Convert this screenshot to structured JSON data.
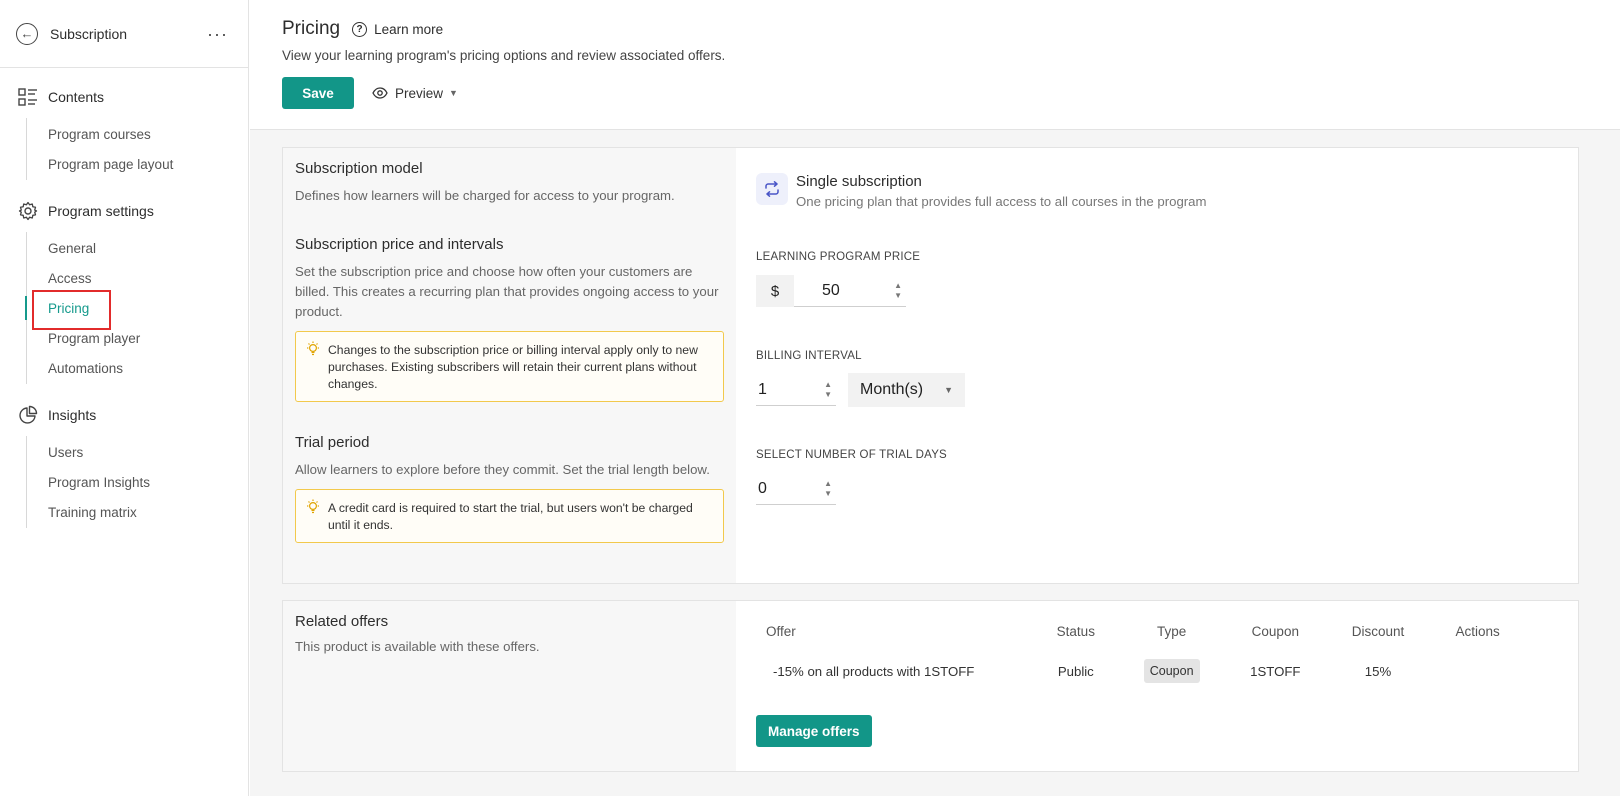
{
  "sidebar": {
    "title": "Subscription",
    "groups": [
      {
        "label": "Contents",
        "items": [
          {
            "label": "Program courses"
          },
          {
            "label": "Program page layout"
          }
        ]
      },
      {
        "label": "Program settings",
        "items": [
          {
            "label": "General"
          },
          {
            "label": "Access"
          },
          {
            "label": "Pricing",
            "active": true
          },
          {
            "label": "Program player"
          },
          {
            "label": "Automations"
          }
        ]
      },
      {
        "label": "Insights",
        "items": [
          {
            "label": "Users"
          },
          {
            "label": "Program Insights"
          },
          {
            "label": "Training matrix"
          }
        ]
      }
    ]
  },
  "header": {
    "title": "Pricing",
    "learn_more": "Learn more",
    "subtitle": "View your learning program's pricing options and review associated offers.",
    "save_label": "Save",
    "preview_label": "Preview"
  },
  "subscription": {
    "model_title": "Subscription model",
    "model_desc": "Defines how learners will be charged for access to your program.",
    "price_title": "Subscription price and intervals",
    "price_desc": "Set the subscription price and choose how often your customers are billed. This creates a recurring plan that provides ongoing access to your product.",
    "price_notice": "Changes to the subscription price or billing interval apply only to new purchases. Existing subscribers will retain their current plans without changes.",
    "trial_title": "Trial period",
    "trial_desc": "Allow learners to explore before they commit. Set the trial length below.",
    "trial_notice": "A credit card is required to start the trial, but users won't be charged until it ends.",
    "selected_model_title": "Single subscription",
    "selected_model_desc": "One pricing plan that provides full access to all courses in the program",
    "price_label": "LEARNING PROGRAM PRICE",
    "currency": "$",
    "price_value": "50",
    "interval_label": "BILLING INTERVAL",
    "interval_value": "1",
    "interval_unit": "Month(s)",
    "trial_label": "SELECT NUMBER OF TRIAL DAYS",
    "trial_value": "0"
  },
  "offers": {
    "title": "Related offers",
    "desc": "This product is available with these offers.",
    "columns": {
      "offer": "Offer",
      "status": "Status",
      "type": "Type",
      "coupon": "Coupon",
      "discount": "Discount",
      "actions": "Actions"
    },
    "rows": [
      {
        "offer": "-15% on all products with 1STOFF",
        "status": "Public",
        "type": "Coupon",
        "coupon": "1STOFF",
        "discount": "15%",
        "actions": ""
      }
    ],
    "manage_label": "Manage offers"
  },
  "colors": {
    "accent": "#129688",
    "highlight": "#e22b2b",
    "notice_border": "#f2c94c"
  }
}
